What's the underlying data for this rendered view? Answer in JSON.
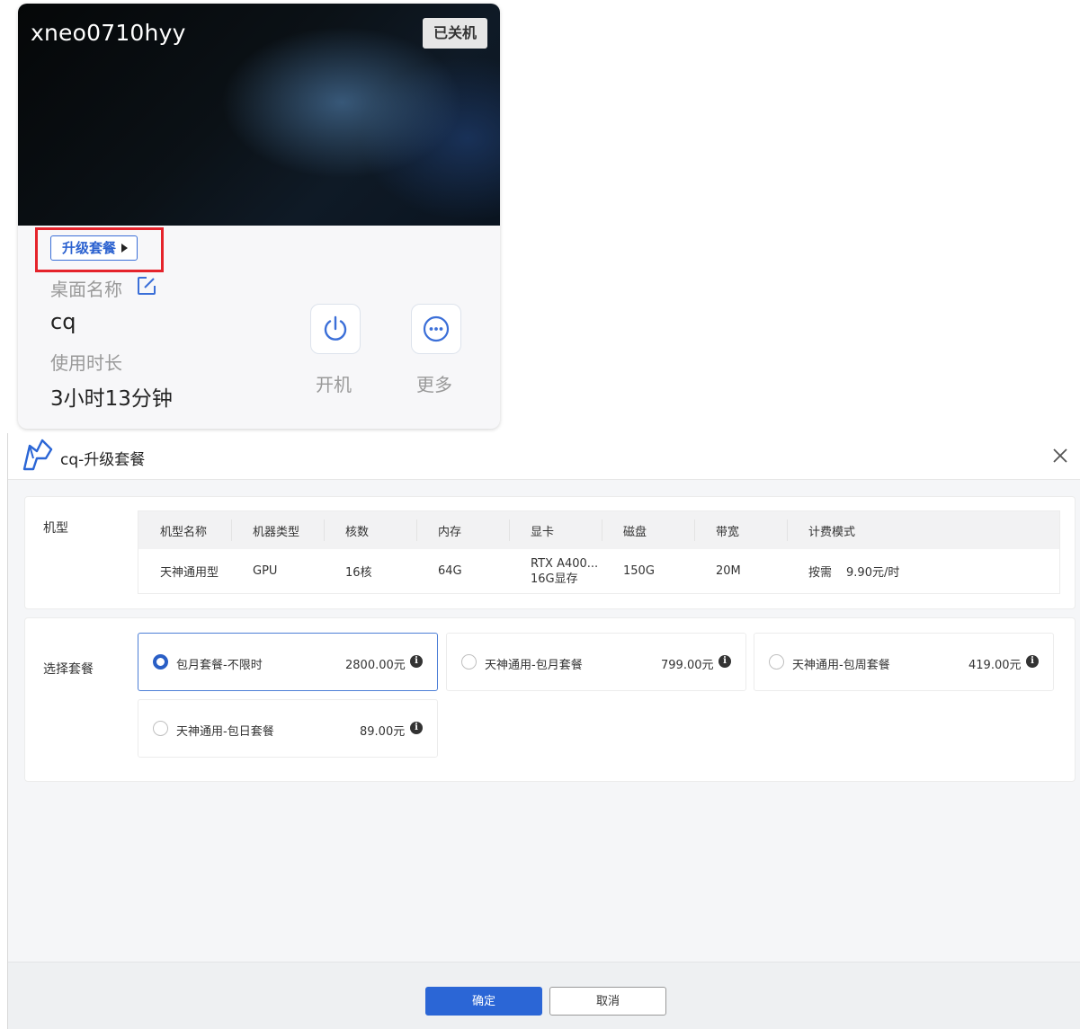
{
  "card": {
    "title": "xneo0710hyy",
    "status": "已关机",
    "upgrade_label": "升级套餐",
    "desktop_name_label": "桌面名称",
    "desktop_name_value": "cq",
    "usage_label": "使用时长",
    "usage_value": "3小时13分钟",
    "power_on_label": "开机",
    "more_label": "更多"
  },
  "dialog": {
    "title": "cq-升级套餐",
    "machine_section_label": "机型",
    "table": {
      "headers": [
        "机型名称",
        "机器类型",
        "核数",
        "内存",
        "显卡",
        "磁盘",
        "带宽",
        "计费模式"
      ],
      "row": {
        "name": "天神通用型",
        "type": "GPU",
        "cores": "16核",
        "memory": "64G",
        "gpu_line1": "RTX A400...",
        "gpu_line2": "16G显存",
        "disk": "150G",
        "bandwidth": "20M",
        "billing_mode": "按需",
        "billing_price": "9.90元/时"
      }
    },
    "package_section_label": "选择套餐",
    "packages": [
      {
        "name": "包月套餐-不限时",
        "price": "2800.00元",
        "selected": true
      },
      {
        "name": "天神通用-包月套餐",
        "price": "799.00元",
        "selected": false
      },
      {
        "name": "天神通用-包周套餐",
        "price": "419.00元",
        "selected": false
      },
      {
        "name": "天神通用-包日套餐",
        "price": "89.00元",
        "selected": false
      }
    ],
    "confirm_label": "确定",
    "cancel_label": "取消"
  },
  "colors": {
    "accent": "#2b66d6",
    "highlight_border": "#e5232b",
    "status_badge_bg": "#e6e6e6"
  },
  "icons": {
    "edit": "edit-icon",
    "power": "power-icon",
    "more": "more-icon",
    "close": "close-icon",
    "info": "info-icon",
    "logo": "app-logo-icon"
  }
}
